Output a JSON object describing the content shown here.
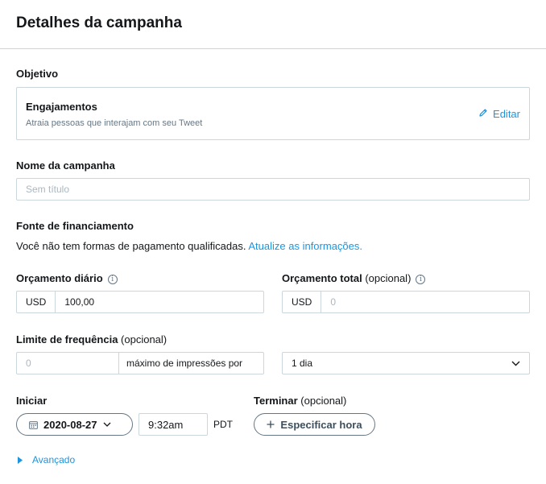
{
  "header": {
    "title": "Detalhes da campanha"
  },
  "objective": {
    "label": "Objetivo",
    "title": "Engajamentos",
    "description": "Atraia pessoas que interajam com seu Tweet",
    "edit_label": "Editar"
  },
  "campaign_name": {
    "label": "Nome da campanha",
    "placeholder": "Sem título"
  },
  "funding": {
    "label": "Fonte de financiamento",
    "message": "Você não tem formas de pagamento qualificadas.",
    "link_text": "Atualize as informações."
  },
  "daily_budget": {
    "label": "Orçamento diário",
    "currency": "USD",
    "value": "100,00"
  },
  "total_budget": {
    "label": "Orçamento total",
    "optional": "(opcional)",
    "currency": "USD",
    "placeholder": "0"
  },
  "frequency_cap": {
    "label": "Limite de frequência",
    "optional": "(opcional)",
    "placeholder": "0",
    "suffix": "máximo de impressões por",
    "period": "1 dia"
  },
  "start": {
    "label": "Iniciar",
    "date": "2020-08-27",
    "time": "9:32am",
    "timezone": "PDT"
  },
  "end": {
    "label": "Terminar",
    "optional": "(opcional)",
    "button_label": "Especificar hora"
  },
  "advanced": {
    "label": "Avançado"
  },
  "colors": {
    "link": "#1b95e0",
    "border": "#ccd6dd",
    "muted": "#657786"
  }
}
